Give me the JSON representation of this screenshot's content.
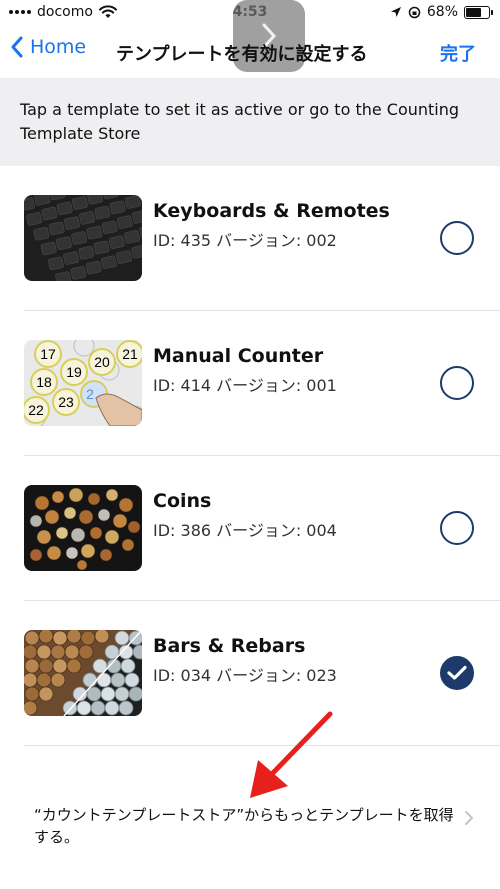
{
  "status_bar": {
    "carrier": "docomo",
    "time": "4:53",
    "battery": "68%",
    "battery_level": 0.68
  },
  "navbar": {
    "back_label": "Home",
    "title": "テンプレートを有効に設定する",
    "done_label": "完了"
  },
  "banner": {
    "text": "Tap a template to set it as active or go to the Counting Template Store"
  },
  "templates": [
    {
      "name": "Keyboards & Remotes",
      "meta": "ID: 435 バージョン: 002",
      "selected": false
    },
    {
      "name": "Manual Counter",
      "meta": "ID: 414 バージョン: 001",
      "selected": false
    },
    {
      "name": "Coins",
      "meta": "ID: 386 バージョン: 004",
      "selected": false
    },
    {
      "name": "Bars & Rebars",
      "meta": "ID: 034 バージョン: 023",
      "selected": true
    }
  ],
  "manual_counter_numbers": [
    "17",
    "20",
    "21",
    "18",
    "19",
    "22",
    "23",
    "2"
  ],
  "store_link": {
    "text": "“カウントテンプレートストア”からもっとテンプレートを取得する。"
  },
  "colors": {
    "accent": "#1a73e8",
    "radio": "#1e3a6b",
    "banner_bg": "#efeff2",
    "annotation_arrow": "#e8201b"
  }
}
